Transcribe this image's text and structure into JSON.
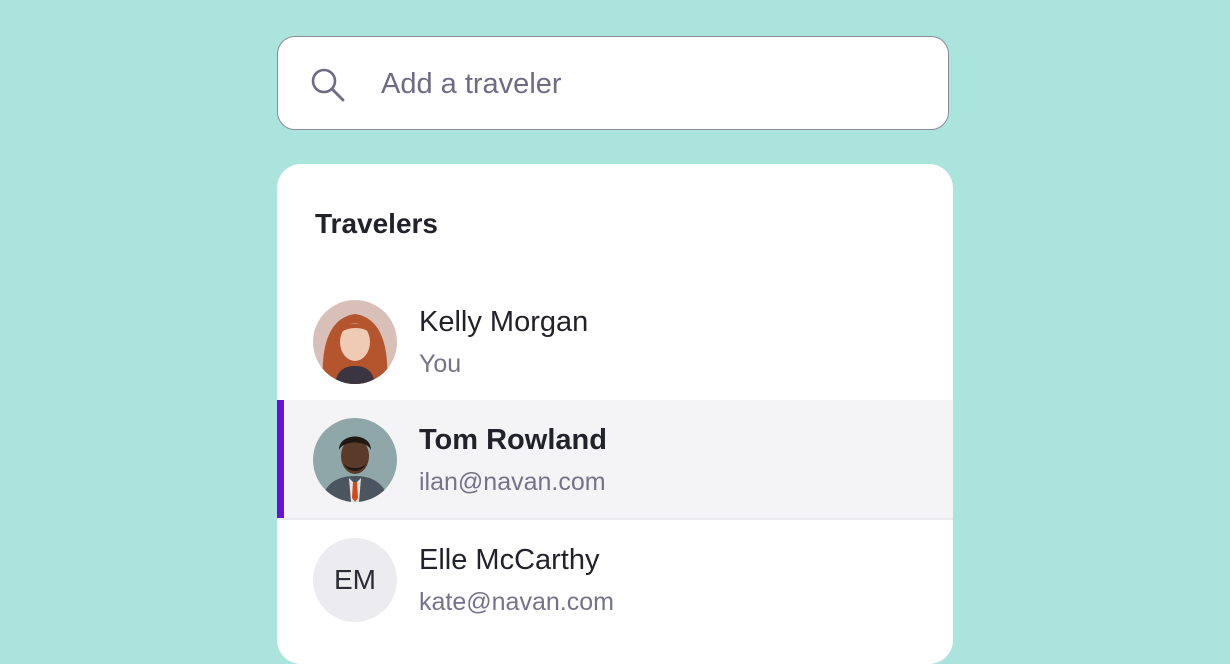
{
  "search": {
    "placeholder": "Add a traveler",
    "value": ""
  },
  "travelers_panel": {
    "title": "Travelers",
    "items": [
      {
        "name": "Kelly Morgan",
        "subtitle": "You",
        "avatar": "photo",
        "selected": false
      },
      {
        "name": "Tom Rowland",
        "subtitle": "ilan@navan.com",
        "avatar": "photo",
        "selected": true
      },
      {
        "name": "Elle McCarthy",
        "subtitle": "kate@navan.com",
        "avatar": "initials",
        "initials": "EM",
        "selected": false
      }
    ]
  },
  "colors": {
    "background": "#ABE4DC",
    "selected_accent": "#6B11D6",
    "selected_row": "#F4F4F7",
    "initials_avatar": "#EBEBF0",
    "secondary_text": "#76728a"
  },
  "icons": {
    "search": "search-icon"
  }
}
